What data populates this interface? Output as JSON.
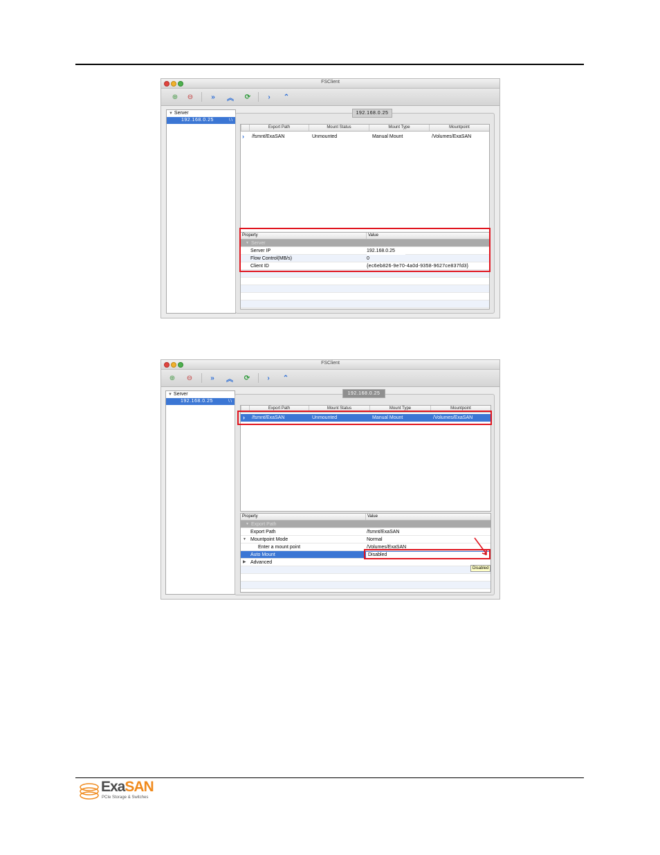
{
  "window_title": "FSClient",
  "toolbar_icons": [
    "add-server-icon",
    "remove-server-icon",
    "mount-all-icon",
    "unmount-all-icon",
    "refresh-icon",
    "mount-icon",
    "unmount-icon"
  ],
  "sidebar": {
    "root": "Server",
    "host": "192.168.0.25",
    "host_marker": "\\ \\"
  },
  "server_tab": "192.168.0.25",
  "columns": [
    "Export Path",
    "Mount Status",
    "Mount Type",
    "Mountpoint"
  ],
  "mount_row": {
    "export_path": "/fsmnt/ExaSAN",
    "mount_status": "Unmounted",
    "mount_type": "Manual Mount",
    "mountpoint": "/Volumes/ExaSAN"
  },
  "prop_headers": {
    "property": "Property",
    "value": "Value"
  },
  "shot1": {
    "group": "Server",
    "rows": [
      {
        "name": "Server IP",
        "value": "192.168.0.25"
      },
      {
        "name": "Flow Control(MB/s)",
        "value": "0"
      },
      {
        "name": "Client ID",
        "value": "{ec6eb826-9e70-4a0d-9358-9627ce837fd3}"
      }
    ]
  },
  "shot2": {
    "group": "Export Path",
    "rows": [
      {
        "name": "Export Path",
        "value": "/fsmnt/ExaSAN"
      },
      {
        "name": "Mountpoint Mode",
        "value": "Normal"
      },
      {
        "name": "Enter a mount point",
        "value": "/Volumes/ExaSAN"
      },
      {
        "name": "Auto Mount",
        "value": "Disabled"
      },
      {
        "name": "Advanced",
        "value": ""
      }
    ],
    "tooltip": "Disabled"
  },
  "footer": {
    "brand_exa": "Exa",
    "brand_san": "SAN",
    "tagline": "PCIe Storage & Switches"
  },
  "colors": {
    "selection": "#3b76d4",
    "annotation": "#e0141e",
    "brand_orange": "#f08a1c"
  }
}
